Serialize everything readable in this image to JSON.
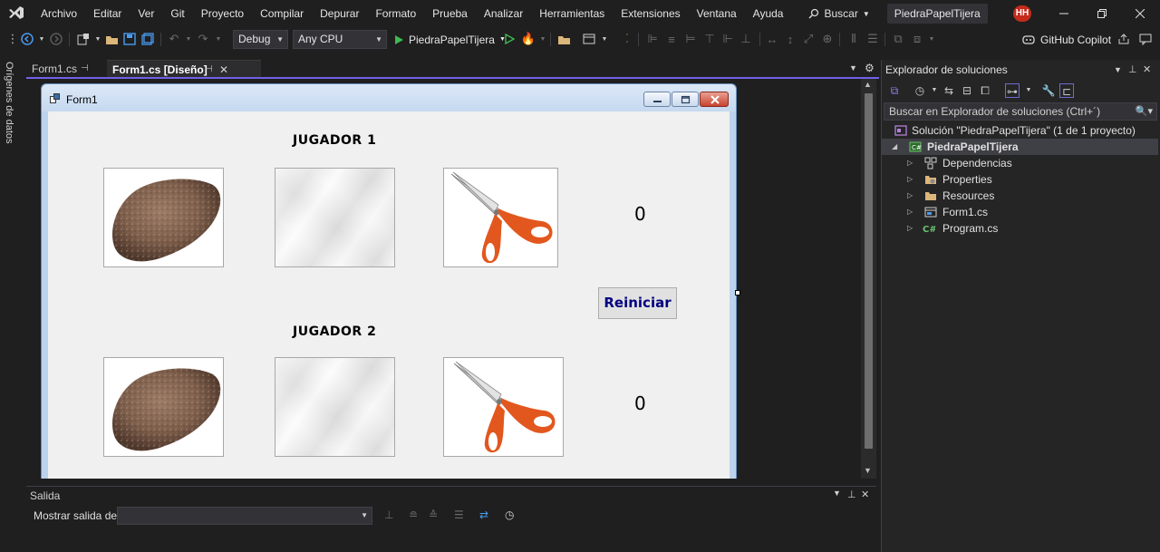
{
  "menu": {
    "items": [
      "Archivo",
      "Editar",
      "Ver",
      "Git",
      "Proyecto",
      "Compilar",
      "Depurar",
      "Formato",
      "Prueba",
      "Analizar",
      "Herramientas",
      "Extensiones",
      "Ventana",
      "Ayuda"
    ],
    "search_label": "Buscar",
    "solution_title": "PiedraPapelTijera",
    "avatar_initials": "HH"
  },
  "toolbar": {
    "configuration": "Debug",
    "platform": "Any CPU",
    "run_target": "PiedraPapelTijera",
    "copilot_label": "GitHub Copilot"
  },
  "side_strip": {
    "data_sources_label": "Orígenes de datos"
  },
  "document_tabs": [
    {
      "label": "Form1.cs",
      "active": false
    },
    {
      "label": "Form1.cs [Diseño]",
      "active": true
    }
  ],
  "form": {
    "title": "Form1",
    "player1_label": "JUGADOR 1",
    "player2_label": "JUGADOR 2",
    "player1_score": "0",
    "player2_score": "0",
    "reset_button_label": "Reiniciar",
    "choices": [
      "stone-image",
      "paper-image",
      "scissors-image"
    ]
  },
  "solution_explorer": {
    "title": "Explorador de soluciones",
    "search_placeholder": "Buscar en Explorador de soluciones (Ctrl+´)",
    "solution_label": "Solución \"PiedraPapelTijera\"  (1 de 1 proyecto)",
    "project_label": "PiedraPapelTijera",
    "items": [
      {
        "label": "Dependencias",
        "icon": "dependencies-icon"
      },
      {
        "label": "Properties",
        "icon": "properties-icon"
      },
      {
        "label": "Resources",
        "icon": "folder-icon"
      },
      {
        "label": "Form1.cs",
        "icon": "form-file-icon"
      },
      {
        "label": "Program.cs",
        "icon": "csharp-file-icon"
      }
    ]
  },
  "output": {
    "title": "Salida",
    "show_output_from_label": "Mostrar salida de:",
    "show_output_from_value": ""
  },
  "colors": {
    "accent": "#7160e8",
    "editor_bg": "#1f1f1f",
    "form_client_bg": "#f0f0f0",
    "reset_text": "#000080",
    "avatar_bg": "#c42b1c"
  }
}
